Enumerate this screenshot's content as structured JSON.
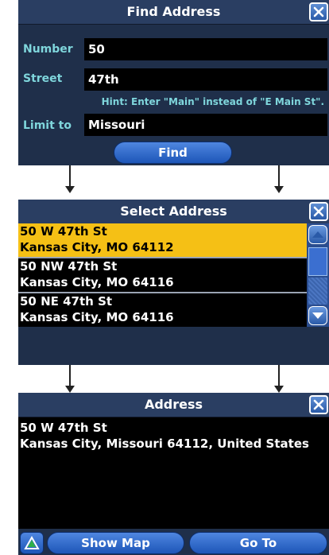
{
  "find_address": {
    "title": "Find Address",
    "number_label": "Number",
    "number_value": "50",
    "street_label": "Street",
    "street_value": "47th",
    "hint": "Hint: Enter \"Main\" instead of \"E Main St\".",
    "limit_label": "Limit to",
    "limit_value": "Missouri",
    "find_button": "Find"
  },
  "select_address": {
    "title": "Select Address",
    "items": [
      {
        "line1": "50 W 47th St",
        "line2": "Kansas City, MO 64112"
      },
      {
        "line1": "50 NW 47th St",
        "line2": "Kansas City, MO 64116"
      },
      {
        "line1": "50 NE 47th St",
        "line2": "Kansas City, MO 64116"
      }
    ]
  },
  "address": {
    "title": "Address",
    "line1": "50 W 47th St",
    "line2": "Kansas City, Missouri 64112, United States",
    "show_map_button": "Show Map",
    "go_to_button": "Go To"
  },
  "colors": {
    "selected_item": "#f5c015",
    "label_text": "#7fd6dc",
    "button": "#1d56b8"
  }
}
